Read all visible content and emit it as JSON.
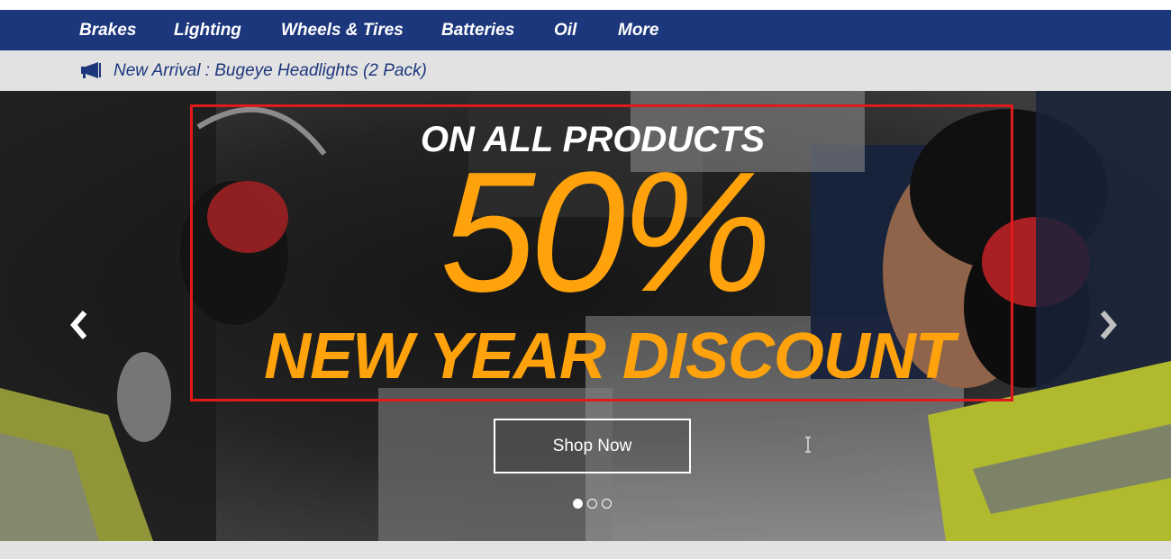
{
  "nav": {
    "items": [
      {
        "label": "Brakes"
      },
      {
        "label": "Lighting"
      },
      {
        "label": "Wheels & Tires"
      },
      {
        "label": "Batteries"
      },
      {
        "label": "Oil"
      },
      {
        "label": "More"
      }
    ]
  },
  "announcement": {
    "icon": "megaphone-icon",
    "text": "New Arrival : Bugeye Headlights (2 Pack)"
  },
  "hero": {
    "line1": "ON ALL PRODUCTS",
    "big": "50%",
    "line3": "NEW YEAR DISCOUNT",
    "button_label": "Shop Now",
    "prev_icon": "chevron-left-icon",
    "next_icon": "chevron-right-icon",
    "slides_total": 3,
    "active_slide": 1
  },
  "colors": {
    "nav_bg": "#1d377d",
    "announce_bg": "#e2e2e2",
    "accent_orange": "#ffa20b",
    "highlight_red": "#e01a1a"
  }
}
